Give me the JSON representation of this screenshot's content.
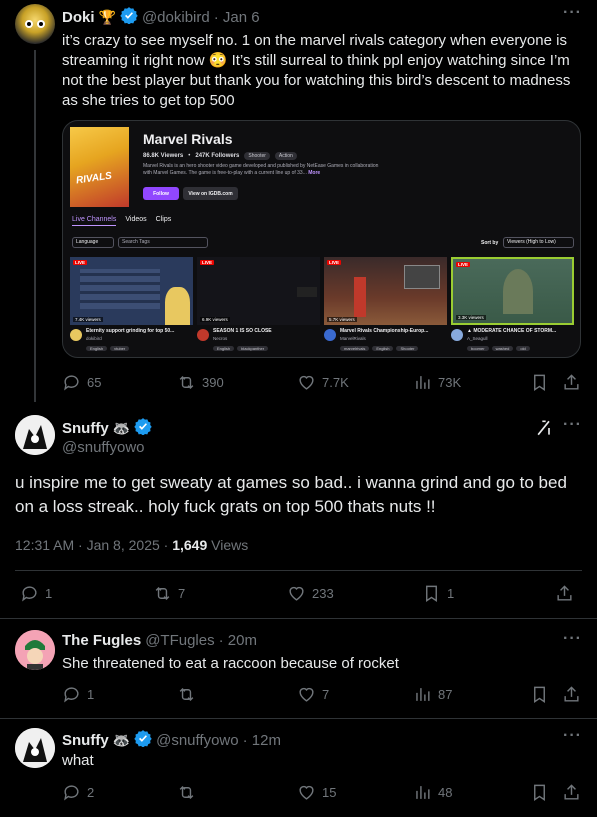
{
  "tweet1": {
    "name": "Doki",
    "badge": "🏆",
    "handle": "@dokibird",
    "time": "· Jan 6",
    "text": "it’s crazy to see myself no. 1 on the marvel rivals category when everyone is streaming it right now 😳 It’s still surreal to think ppl enjoy watching since I’m not the best player but thank you for watching this bird’s descent to madness as she tries to get top 500",
    "stats": {
      "replies": "65",
      "reposts": "390",
      "likes": "7.7K",
      "views": "73K"
    },
    "embed": {
      "game_title": "Marvel Rivals",
      "viewers": "86.8K Viewers",
      "followers": "247K Followers",
      "tags": [
        "Shooter",
        "Action"
      ],
      "description": "Marvel Rivals is an hero shooter video game developed and published by NetEase Games in collaboration with Marvel Games. The game is free-to-play with a current line up of 33...",
      "more": "More",
      "follow_btn": "Follow",
      "igdb_btn": "View on IGDB.com",
      "tabs": [
        "Live Channels",
        "Videos",
        "Clips"
      ],
      "language_label": "Language",
      "search_placeholder": "Search Tags",
      "sort_label": "Sort by",
      "sort_value": "Viewers (High to Low)",
      "live_label": "LIVE",
      "streams": [
        {
          "viewers": "7.4K viewers",
          "title": "Eternity support grinding for top 50...",
          "channel": "dokibird",
          "tags": [
            "English",
            "vtuber"
          ],
          "color": "#2a3a5c"
        },
        {
          "viewers": "6.9K viewers",
          "title": "SEASON 1 IS SO CLOSE",
          "channel": "Necros",
          "tags": [
            "English",
            "blackpanther"
          ],
          "color": "#141419"
        },
        {
          "viewers": "5.7K viewers",
          "title": "Marvel Rivals Championship-Europ...",
          "channel": "MarvelRivals",
          "tags": [
            "marvelrivals",
            "English",
            "Shooter"
          ],
          "color": "#6a3a2a"
        },
        {
          "viewers": "3.3K viewers",
          "title": "▲ MODERATE CHANCE OF STORM...",
          "channel": "A_Seagull",
          "tags": [
            "boomer",
            "washed",
            "old"
          ],
          "color": "#3a5a48"
        }
      ]
    }
  },
  "tweet2": {
    "name": "Snuffy",
    "badge": "🦝",
    "handle": "@snuffyowo",
    "text": "u inspire me to get sweaty at games so bad.. i wanna grind and go to bed on a loss streak.. holy fuck grats on top 500 thats nuts !!",
    "timestamp": "12:31 AM · Jan 8, 2025 · ",
    "views_count": "1,649",
    "views_label": " Views",
    "stats": {
      "replies": "1",
      "reposts": "7",
      "likes": "233",
      "bookmarks": "1"
    }
  },
  "reply1": {
    "name": "The Fugles",
    "handle": "@TFugles",
    "time": "· 20m",
    "text": "She threatened to eat a raccoon because of rocket",
    "stats": {
      "replies": "1",
      "reposts": "",
      "likes": "7",
      "views": "87"
    }
  },
  "reply2": {
    "name": "Snuffy",
    "badge": "🦝",
    "handle": "@snuffyowo",
    "time": "· 12m",
    "text": "what",
    "stats": {
      "replies": "2",
      "reposts": "",
      "likes": "15",
      "views": "48"
    }
  },
  "colors": {
    "background": "#000000",
    "text": "#e7e9ea",
    "muted": "#71767b",
    "verified": "#1d9bf0",
    "twitch": "#9147ff"
  },
  "icons": [
    "reply-icon",
    "repost-icon",
    "like-icon",
    "views-icon",
    "bookmark-icon",
    "share-icon",
    "grok-icon",
    "more-icon",
    "verified-icon",
    "trophy-icon",
    "raccoon-icon"
  ]
}
